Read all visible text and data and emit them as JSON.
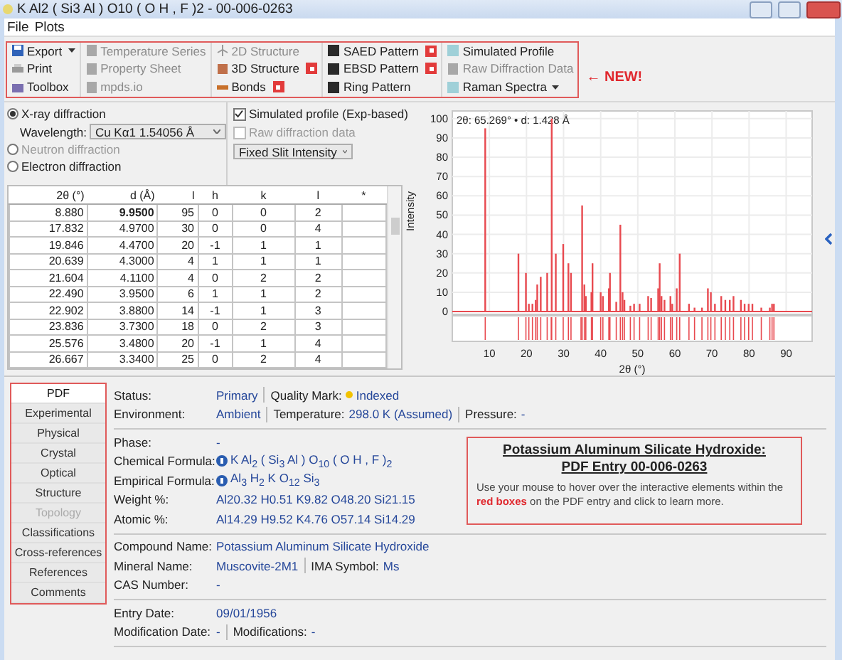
{
  "window": {
    "title": "K Al2 ( Si3 Al ) O10 ( O H , F )2 - 00-006-0263"
  },
  "menu": [
    "File",
    "Plots"
  ],
  "toolbar": {
    "columns": [
      [
        {
          "label": "Export",
          "kind": "save",
          "dropdown": true,
          "disabled": false,
          "badge": false
        },
        {
          "label": "Print",
          "kind": "print",
          "dropdown": false,
          "disabled": false,
          "badge": false
        },
        {
          "label": "Toolbox",
          "kind": "toolbox",
          "dropdown": false,
          "disabled": false,
          "badge": false
        }
      ],
      [
        {
          "label": "Temperature Series",
          "kind": "sheet",
          "dropdown": false,
          "disabled": true,
          "badge": false
        },
        {
          "label": "Property Sheet",
          "kind": "sheet",
          "dropdown": false,
          "disabled": true,
          "badge": false
        },
        {
          "label": "mpds.io",
          "kind": "sheet",
          "dropdown": false,
          "disabled": true,
          "badge": false
        }
      ],
      [
        {
          "label": "2D Structure",
          "kind": "atom",
          "dropdown": false,
          "disabled": true,
          "badge": false
        },
        {
          "label": "3D Structure",
          "kind": "cube",
          "dropdown": false,
          "disabled": false,
          "badge": true
        },
        {
          "label": "Bonds",
          "kind": "bonds",
          "dropdown": false,
          "disabled": false,
          "badge": true
        }
      ],
      [
        {
          "label": "SAED Pattern",
          "kind": "pattern",
          "dropdown": false,
          "disabled": false,
          "badge": true
        },
        {
          "label": "EBSD Pattern",
          "kind": "pattern",
          "dropdown": false,
          "disabled": false,
          "badge": true
        },
        {
          "label": "Ring Pattern",
          "kind": "pattern",
          "dropdown": false,
          "disabled": false,
          "badge": false
        }
      ],
      [
        {
          "label": "Simulated Profile",
          "kind": "profile",
          "dropdown": false,
          "disabled": false,
          "badge": false
        },
        {
          "label": "Raw Diffraction Data",
          "kind": "sheet",
          "dropdown": false,
          "disabled": true,
          "badge": false
        },
        {
          "label": "Raman Spectra",
          "kind": "profile",
          "dropdown": true,
          "disabled": false,
          "badge": false
        }
      ]
    ],
    "new_label": "← NEW!"
  },
  "diffraction": {
    "radios": [
      {
        "label": "X-ray diffraction",
        "selected": true,
        "disabled": false
      },
      {
        "label": "Neutron diffraction",
        "selected": false,
        "disabled": true
      },
      {
        "label": "Electron diffraction",
        "selected": false,
        "disabled": false
      }
    ],
    "wavelength": {
      "label": "Wavelength:",
      "value": "Cu Kα1 1.54056 Å"
    }
  },
  "profile": {
    "checkboxes": [
      {
        "label": "Simulated profile (Exp-based)",
        "checked": true,
        "disabled": false
      },
      {
        "label": "Raw diffraction data",
        "checked": false,
        "disabled": true
      }
    ],
    "intensity_mode": {
      "value": "Fixed Slit Intensity"
    }
  },
  "table": {
    "columns": [
      "2θ (°)",
      "d (Å)",
      "I",
      "h",
      "k",
      "l",
      "*"
    ],
    "rows": [
      {
        "cells": [
          "8.880",
          "9.9500",
          "95",
          "0",
          "0",
          "2",
          ""
        ],
        "strongest": true
      },
      {
        "cells": [
          "17.832",
          "4.9700",
          "30",
          "0",
          "0",
          "4",
          ""
        ],
        "strongest": false
      },
      {
        "cells": [
          "19.846",
          "4.4700",
          "20",
          "-1",
          "1",
          "1",
          ""
        ],
        "strongest": false
      },
      {
        "cells": [
          "20.639",
          "4.3000",
          "4",
          "1",
          "1",
          "1",
          ""
        ],
        "strongest": false
      },
      {
        "cells": [
          "21.604",
          "4.1100",
          "4",
          "0",
          "2",
          "2",
          ""
        ],
        "strongest": false
      },
      {
        "cells": [
          "22.490",
          "3.9500",
          "6",
          "1",
          "1",
          "2",
          ""
        ],
        "strongest": false
      },
      {
        "cells": [
          "22.902",
          "3.8800",
          "14",
          "-1",
          "1",
          "3",
          ""
        ],
        "strongest": false
      },
      {
        "cells": [
          "23.836",
          "3.7300",
          "18",
          "0",
          "2",
          "3",
          ""
        ],
        "strongest": false
      },
      {
        "cells": [
          "25.576",
          "3.4800",
          "20",
          "-1",
          "1",
          "4",
          ""
        ],
        "strongest": false
      },
      {
        "cells": [
          "26.667",
          "3.3400",
          "25",
          "0",
          "2",
          "4",
          ""
        ],
        "strongest": false
      }
    ]
  },
  "chart": {
    "readout": "2θ: 65.269° • d: 1.428 Å",
    "chart_data": {
      "type": "bar",
      "xlabel": "2θ (°)",
      "ylabel": "Intensity",
      "grid": true,
      "x": [
        8.88,
        17.83,
        19.85,
        20.64,
        21.6,
        22.49,
        22.9,
        23.84,
        25.58,
        26.67,
        26.8,
        27.9,
        29.9,
        31.3,
        32.0,
        34.7,
        35.0,
        35.6,
        36.0,
        37.5,
        37.8,
        40.0,
        40.6,
        42.2,
        42.5,
        44.2,
        45.3,
        45.9,
        46.4,
        48.0,
        49.0,
        50.5,
        52.8,
        53.6,
        55.5,
        55.9,
        56.4,
        57.2,
        58.8,
        59.3,
        60.5,
        61.3,
        63.8,
        65.3,
        67.3,
        68.9,
        69.7,
        70.8,
        72.5,
        73.6,
        74.8,
        75.8,
        77.8,
        78.8,
        79.9,
        80.9,
        83.3,
        85.6,
        86.2,
        86.7
      ],
      "series": [
        {
          "color": "#e8494f",
          "values": [
            95,
            30,
            20,
            4,
            4,
            6,
            14,
            18,
            20,
            null,
            100,
            30,
            35,
            25,
            20,
            null,
            55,
            14,
            8,
            10,
            25,
            10,
            8,
            12,
            20,
            5,
            45,
            10,
            6,
            3,
            4,
            4,
            8,
            7,
            12,
            25,
            8,
            6,
            8,
            4,
            12,
            30,
            4,
            2,
            2,
            12,
            10,
            4,
            8,
            6,
            6,
            8,
            6,
            4,
            4,
            4,
            2,
            2,
            4,
            4
          ]
        }
      ],
      "xlim": [
        0,
        97
      ],
      "ylim": [
        0,
        104
      ],
      "xticks": [
        10,
        20,
        30,
        40,
        50,
        60,
        70,
        80,
        90
      ],
      "yticks": [
        0,
        10,
        20,
        30,
        40,
        50,
        60,
        70,
        80,
        90,
        100
      ]
    }
  },
  "nav": [
    {
      "label": "PDF",
      "selected": true,
      "disabled": false
    },
    {
      "label": "Experimental",
      "selected": false,
      "disabled": false
    },
    {
      "label": "Physical",
      "selected": false,
      "disabled": false
    },
    {
      "label": "Crystal",
      "selected": false,
      "disabled": false
    },
    {
      "label": "Optical",
      "selected": false,
      "disabled": false
    },
    {
      "label": "Structure",
      "selected": false,
      "disabled": false
    },
    {
      "label": "Topology",
      "selected": false,
      "disabled": true
    },
    {
      "label": "Classifications",
      "selected": false,
      "disabled": false
    },
    {
      "label": "Cross-references",
      "selected": false,
      "disabled": false
    },
    {
      "label": "References",
      "selected": false,
      "disabled": false
    },
    {
      "label": "Comments",
      "selected": false,
      "disabled": false
    }
  ],
  "entry": {
    "sections": [
      [
        [
          {
            "label": "Status:",
            "value": "Primary"
          },
          {
            "label": "Quality Mark:",
            "value": "Indexed",
            "color": "#f2c200"
          }
        ],
        [
          {
            "label": "Environment:",
            "value": "Ambient"
          },
          {
            "label": "Temperature:",
            "value": "298.0 K (Assumed)"
          },
          {
            "label": "Pressure:",
            "value": "-"
          }
        ]
      ],
      [
        [
          {
            "label": "Phase:",
            "value": "-"
          }
        ],
        [
          {
            "label": "Chemical Formula:",
            "value": "K Al$_{2}$ ( Si$_{3}$ Al ) O$_{10}$ ( O H , F )$_{2}$",
            "info": true
          }
        ],
        [
          {
            "label": "Empirical Formula:",
            "value": "Al$_{3}$ H$_{2}$ K O$_{12}$ Si$_{3}$",
            "info": true
          }
        ],
        [
          {
            "label": "Weight %:",
            "value": "Al20.32 H0.51 K9.82 O48.20 Si21.15"
          }
        ],
        [
          {
            "label": "Atomic %:",
            "value": "Al14.29 H9.52 K4.76 O57.14 Si14.29"
          }
        ]
      ],
      [
        [
          {
            "label": "Compound Name:",
            "value": "Potassium Aluminum Silicate Hydroxide"
          }
        ],
        [
          {
            "label": "Mineral Name:",
            "value": "Muscovite-2M1"
          },
          {
            "label": "IMA Symbol:",
            "value": "Ms"
          }
        ],
        [
          {
            "label": "CAS Number:",
            "value": "-"
          }
        ]
      ],
      [
        [
          {
            "label": "Entry Date:",
            "value": "09/01/1956"
          }
        ],
        [
          {
            "label": "Modification Date:",
            "value": "-"
          },
          {
            "label": "Modifications:",
            "value": "-"
          }
        ]
      ]
    ]
  },
  "info_box": {
    "title_lines": [
      "Potassium Aluminum Silicate Hydroxide:",
      "PDF Entry 00-006-0263"
    ],
    "text": "Use your mouse to hover over the interactive elements within the **red boxes** on the PDF entry and click to learn more."
  }
}
